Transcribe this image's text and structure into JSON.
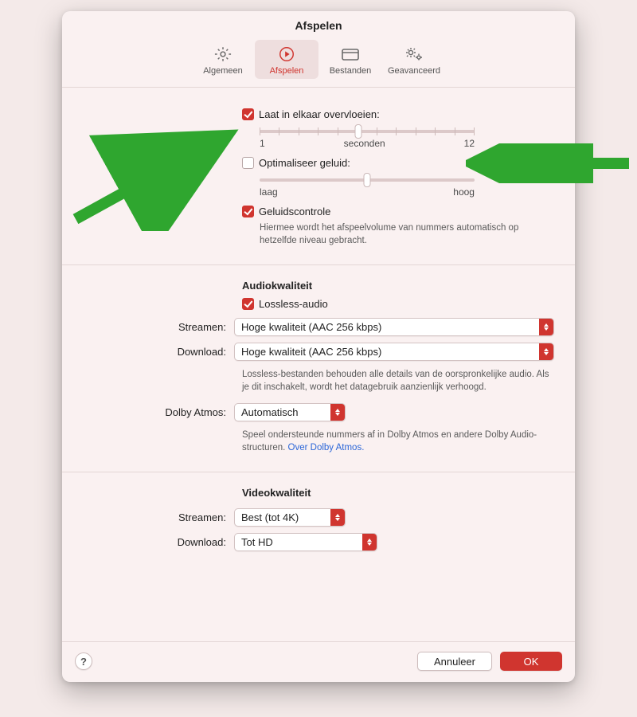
{
  "title": "Afspelen",
  "tabs": [
    {
      "label": "Algemeen"
    },
    {
      "label": "Afspelen"
    },
    {
      "label": "Bestanden"
    },
    {
      "label": "Geavanceerd"
    }
  ],
  "crossfade": {
    "label": "Laat in elkaar overvloeien:",
    "min_label": "1",
    "unit_label": "seconden",
    "max_label": "12"
  },
  "enhancer": {
    "label": "Optimaliseer geluid:",
    "low_label": "laag",
    "high_label": "hoog"
  },
  "soundcheck": {
    "label": "Geluidscontrole",
    "desc": "Hiermee wordt het afspeelvolume van nummers automatisch op hetzelfde niveau gebracht."
  },
  "audio": {
    "heading": "Audiokwaliteit",
    "lossless_label": "Lossless-audio",
    "stream_label": "Streamen:",
    "stream_value": "Hoge kwaliteit (AAC 256 kbps)",
    "download_label": "Download:",
    "download_value": "Hoge kwaliteit (AAC 256 kbps)",
    "desc": "Lossless-bestanden behouden alle details van de oorspronkelijke audio. Als je dit inschakelt, wordt het datagebruik aanzienlijk verhoogd.",
    "dolby_label": "Dolby Atmos:",
    "dolby_value": "Automatisch",
    "dolby_desc_a": "Speel ondersteunde nummers af in Dolby Atmos en andere Dolby Audio-structuren. ",
    "dolby_link": "Over Dolby Atmos."
  },
  "video": {
    "heading": "Videokwaliteit",
    "stream_label": "Streamen:",
    "stream_value": "Best (tot 4K)",
    "download_label": "Download:",
    "download_value": "Tot HD"
  },
  "footer": {
    "help": "?",
    "cancel": "Annuleer",
    "ok": "OK"
  }
}
